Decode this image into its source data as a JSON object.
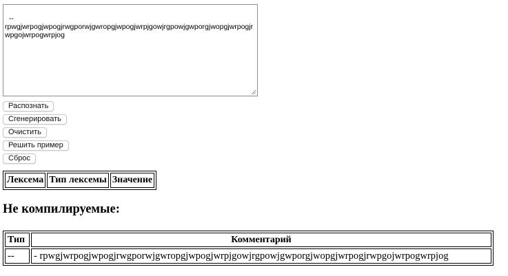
{
  "editor": {
    "text": "--\nrpwgjwrpogjwpogjrwgporwjgwropgjwpogjwrpjgowjrgpowjgwporgjwopgjwrpogjrwpgojwrpogwrpjog"
  },
  "buttons": {
    "recognize": "Распознать",
    "generate": "Сгенерировать",
    "clear": "Очистить",
    "solve_example": "Решить пример",
    "reset": "Сброс"
  },
  "lexeme_table": {
    "columns": [
      "Лексема",
      "Тип лексемы",
      "Значение"
    ],
    "rows": []
  },
  "non_compiled": {
    "heading": "Не компилируемые:",
    "columns": [
      "Тип",
      "Комментарий"
    ],
    "rows": [
      {
        "type": "--",
        "comment": "- rpwgjwrpogjwpogjrwgporwjgwropgjwpogjwrpjgowjrgpowjgwporgjwopgjwrpogjrwpgojwrpogwrpjog"
      }
    ]
  }
}
